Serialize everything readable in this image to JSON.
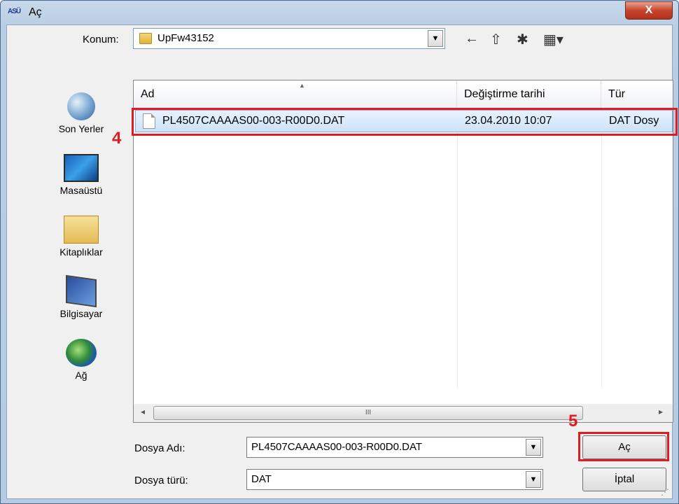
{
  "window": {
    "title": "Aç",
    "title_icon": "ASÜ",
    "close_label": "X"
  },
  "location": {
    "label": "Konum:",
    "value": "UpFw43152"
  },
  "toolbar": {
    "back_icon": "←",
    "up_icon": "⇧",
    "newfolder_icon": "✱",
    "view_icon": "▦▾"
  },
  "places": [
    {
      "label": "Son Yerler",
      "icon": "recent-places-icon"
    },
    {
      "label": "Masaüstü",
      "icon": "desktop-icon"
    },
    {
      "label": "Kitaplıklar",
      "icon": "libraries-icon"
    },
    {
      "label": "Bilgisayar",
      "icon": "computer-icon"
    },
    {
      "label": "Ağ",
      "icon": "network-icon"
    }
  ],
  "columns": {
    "name": "Ad",
    "date": "Değiştirme tarihi",
    "type": "Tür"
  },
  "files": [
    {
      "name": "PL4507CAAAAS00-003-R00D0.DAT",
      "date": "23.04.2010 10:07",
      "type": "DAT Dosy"
    }
  ],
  "scrollbar": {
    "left": "◂",
    "right": "▸",
    "grip": "III"
  },
  "form": {
    "filename_label": "Dosya Adı:",
    "filename_value": "PL4507CAAAAS00-003-R00D0.DAT",
    "filetype_label": "Dosya türü:",
    "filetype_value": "DAT"
  },
  "buttons": {
    "open": "Aç",
    "cancel": "İptal"
  },
  "annotations": {
    "step4": "4",
    "step5": "5",
    "color": "#e01b22"
  }
}
